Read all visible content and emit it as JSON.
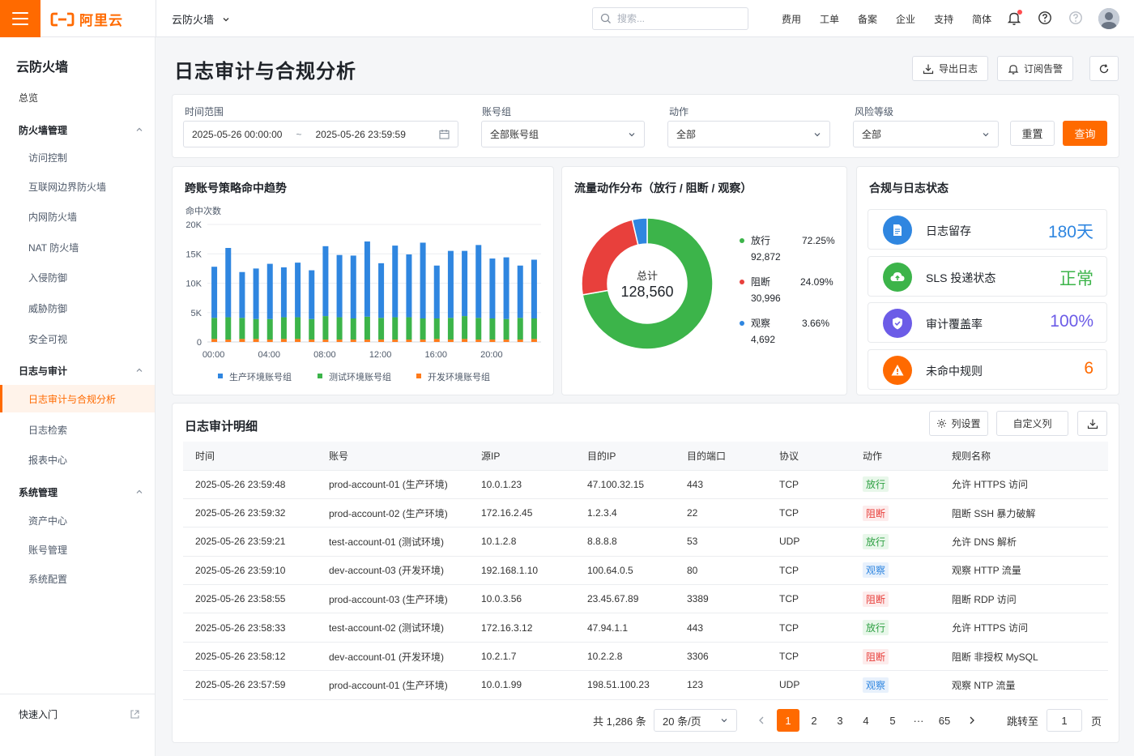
{
  "topbar": {
    "logo_text": "阿里云",
    "product": "云防火墙",
    "search_placeholder": "搜索...",
    "nav": [
      "费用",
      "工单",
      "备案",
      "企业",
      "支持",
      "简体"
    ]
  },
  "sidebar": {
    "title": "云防火墙",
    "overview": "总览",
    "groups": [
      {
        "label": "防火墙管理",
        "items": [
          "访问控制",
          "互联网边界防火墙",
          "内网防火墙",
          "NAT 防火墙",
          "入侵防御",
          "威胁防御",
          "安全可视"
        ]
      },
      {
        "label": "日志与审计",
        "items": [
          "日志审计与合规分析",
          "日志检索",
          "报表中心"
        ]
      },
      {
        "label": "系统管理",
        "items": [
          "资产中心",
          "账号管理",
          "系统配置"
        ]
      }
    ],
    "quick_start": "快速入门"
  },
  "page": {
    "title": "日志审计与合规分析",
    "export_label": "导出日志",
    "subscribe_label": "订阅告警"
  },
  "filters": {
    "time_label": "时间范围",
    "time_start": "2025-05-26 00:00:00",
    "time_sep": "~",
    "time_end": "2025-05-26 23:59:59",
    "account_label": "账号组",
    "account_value": "全部账号组",
    "action_label": "动作",
    "action_value": "全部",
    "risk_label": "风险等级",
    "risk_value": "全部",
    "reset_label": "重置",
    "query_label": "查询"
  },
  "trend_card": {
    "title": "跨账号策略命中趋势"
  },
  "donut_card": {
    "title": "流量动作分布（放行 / 阻断 / 观察）",
    "center_label": "总计",
    "center_value": "128,560",
    "items": [
      {
        "name": "放行",
        "percent": "72.25%",
        "count": "92,872",
        "value": 72.25,
        "color": "#3cb44a"
      },
      {
        "name": "阻断",
        "percent": "24.09%",
        "count": "30,996",
        "value": 24.09,
        "color": "#e8403c"
      },
      {
        "name": "观察",
        "percent": "3.66%",
        "count": "4,692",
        "value": 3.66,
        "color": "#2f86e0"
      }
    ]
  },
  "status_card": {
    "title": "合规与日志状态",
    "items": [
      {
        "label": "日志留存",
        "value": "180天",
        "color": "#2f86e0",
        "icon": "document-icon"
      },
      {
        "label": "SLS 投递状态",
        "value": "正常",
        "color": "#3cb44a",
        "icon": "cloud-upload-icon"
      },
      {
        "label": "审计覆盖率",
        "value": "100%",
        "color": "#6c5ce7",
        "icon": "shield-check-icon"
      },
      {
        "label": "未命中规则",
        "value": "6",
        "color": "#ff6a00",
        "icon": "warning-icon"
      }
    ]
  },
  "table": {
    "title": "日志审计明细",
    "col_settings_label": "列设置",
    "custom_cols_label": "自定义列",
    "headers": [
      "时间",
      "账号",
      "源IP",
      "目的IP",
      "目的端口",
      "协议",
      "动作",
      "规则名称"
    ],
    "rows": [
      [
        "2025-05-26 23:59:48",
        "prod-account-01 (生产环境)",
        "10.0.1.23",
        "47.100.32.15",
        "443",
        "TCP",
        "放行",
        "允许 HTTPS 访问"
      ],
      [
        "2025-05-26 23:59:32",
        "prod-account-02 (生产环境)",
        "172.16.2.45",
        "1.2.3.4",
        "22",
        "TCP",
        "阻断",
        "阻断 SSH 暴力破解"
      ],
      [
        "2025-05-26 23:59:21",
        "test-account-01 (测试环境)",
        "10.1.2.8",
        "8.8.8.8",
        "53",
        "UDP",
        "放行",
        "允许 DNS 解析"
      ],
      [
        "2025-05-26 23:59:10",
        "dev-account-03 (开发环境)",
        "192.168.1.10",
        "100.64.0.5",
        "80",
        "TCP",
        "观察",
        "观察 HTTP 流量"
      ],
      [
        "2025-05-26 23:58:55",
        "prod-account-03 (生产环境)",
        "10.0.3.56",
        "23.45.67.89",
        "3389",
        "TCP",
        "阻断",
        "阻断 RDP 访问"
      ],
      [
        "2025-05-26 23:58:33",
        "test-account-02 (测试环境)",
        "172.16.3.12",
        "47.94.1.1",
        "443",
        "TCP",
        "放行",
        "允许 HTTPS 访问"
      ],
      [
        "2025-05-26 23:58:12",
        "dev-account-01 (开发环境)",
        "10.2.1.7",
        "10.2.2.8",
        "3306",
        "TCP",
        "阻断",
        "阻断 非授权 MySQL"
      ],
      [
        "2025-05-26 23:57:59",
        "prod-account-01 (生产环境)",
        "10.0.1.99",
        "198.51.100.23",
        "123",
        "UDP",
        "观察",
        "观察 NTP 流量"
      ]
    ],
    "action_colors": {
      "放行": {
        "fg": "#2ea043",
        "bg": "#e8f7ea"
      },
      "阻断": {
        "fg": "#e8403c",
        "bg": "#fdecec"
      },
      "观察": {
        "fg": "#2f86e0",
        "bg": "#e8f1fc"
      }
    }
  },
  "pagination": {
    "total": "共 1,286 条",
    "page_size": "20 条/页",
    "pages": [
      "1",
      "2",
      "3",
      "4",
      "5",
      "···",
      "65"
    ],
    "active_page": "1",
    "jump_label": "跳转至",
    "jump_value": "1",
    "page_suffix": "页"
  },
  "chart_data": {
    "type": "bar",
    "stacked": true,
    "title": "跨账号策略命中趋势",
    "ylabel": "命中次数",
    "xlabel": "",
    "ylim": [
      0,
      20000
    ],
    "yticks": [
      0,
      5000,
      10000,
      15000,
      20000
    ],
    "ytick_labels": [
      "0",
      "5K",
      "10K",
      "15K",
      "20K"
    ],
    "xticks": [
      "00:00",
      "04:00",
      "08:00",
      "12:00",
      "16:00",
      "20:00"
    ],
    "categories": [
      "00:00",
      "01:00",
      "02:00",
      "03:00",
      "04:00",
      "05:00",
      "06:00",
      "07:00",
      "08:00",
      "09:00",
      "10:00",
      "11:00",
      "12:00",
      "13:00",
      "14:00",
      "15:00",
      "16:00",
      "17:00",
      "18:00",
      "19:00",
      "20:00",
      "21:00",
      "22:00",
      "23:00"
    ],
    "grid": true,
    "legend_position": "bottom",
    "series": [
      {
        "name": "生产环境账号组",
        "color": "#2f86e0",
        "values": [
          8700,
          11800,
          7800,
          8600,
          9400,
          8500,
          9300,
          8300,
          11900,
          10600,
          10700,
          12800,
          9300,
          12200,
          10700,
          12900,
          9000,
          11400,
          11100,
          12400,
          10200,
          10500,
          8900,
          10000
        ]
      },
      {
        "name": "测试环境账号组",
        "color": "#3cb44a",
        "values": [
          3600,
          3800,
          3600,
          3400,
          3500,
          3700,
          3700,
          3500,
          4000,
          3800,
          3600,
          3900,
          3700,
          3800,
          3800,
          3600,
          3500,
          3700,
          3900,
          3700,
          3600,
          3500,
          3700,
          3500
        ]
      },
      {
        "name": "开发环境账号组",
        "color": "#ff7a1a",
        "values": [
          500,
          400,
          500,
          500,
          400,
          500,
          500,
          400,
          400,
          400,
          400,
          400,
          400,
          400,
          400,
          400,
          500,
          400,
          500,
          400,
          400,
          400,
          400,
          500
        ]
      }
    ]
  }
}
